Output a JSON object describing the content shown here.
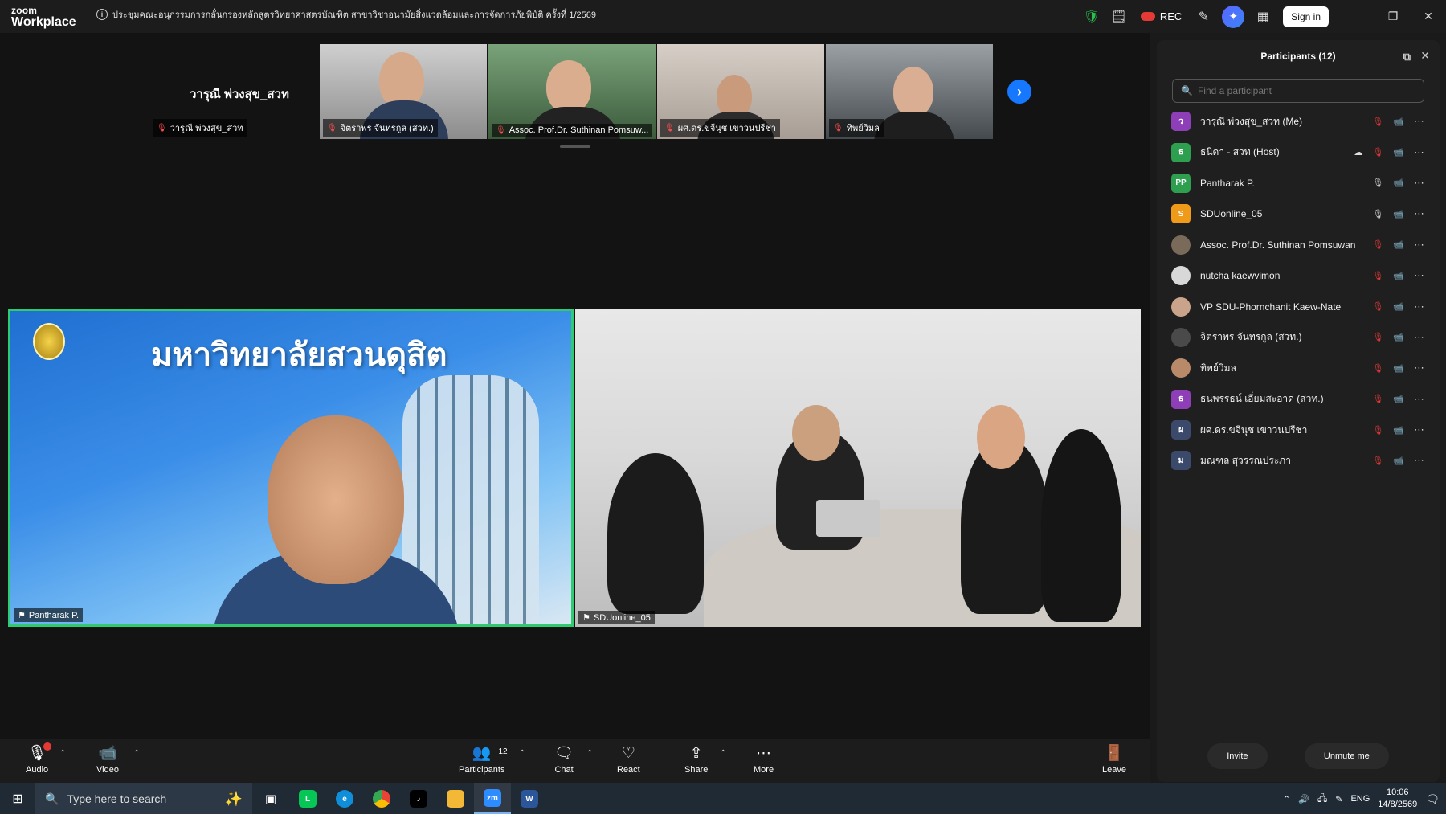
{
  "app": {
    "logo_line1": "zoom",
    "logo_line2": "Workplace"
  },
  "meeting": {
    "title": "ประชุมคณะอนุกรรมการกลั่นกรองหลักสูตรวิทยาศาสตรบัณฑิต สาขาวิชาอนามัยสิ่งแวดล้อมและการจัดการภัยพิบัติ ครั้งที่ 1/2569"
  },
  "titlebar": {
    "rec_label": "REC",
    "signin_label": "Sign in"
  },
  "thumbnails": {
    "self_display_name": "วารุณี พ่วงสุข_สวท",
    "self_label": "วารุณี พ่วงสุข_สวท",
    "tiles": [
      {
        "label": "จิตราพร จันทรกูล (สวท.)"
      },
      {
        "label": "Assoc. Prof.Dr. Suthinan Pomsuw..."
      },
      {
        "label": "ผศ.ดร.ขจีนุช เขาวนปรีชา"
      },
      {
        "label": "ทิพย์วิมล"
      }
    ]
  },
  "main_videos": {
    "left": {
      "label": "Pantharak P.",
      "banner_text": "มหาวิทยาลัยสวนดุสิต"
    },
    "right": {
      "label": "SDUonline_05"
    }
  },
  "toolbar": {
    "audio": "Audio",
    "video": "Video",
    "participants": "Participants",
    "participants_count": "12",
    "chat": "Chat",
    "react": "React",
    "share": "Share",
    "more": "More",
    "leave": "Leave"
  },
  "panel": {
    "title": "Participants (12)",
    "search_placeholder": "Find a participant",
    "invite": "Invite",
    "unmute_me": "Unmute me",
    "participants": [
      {
        "initial": "ว",
        "color": "#8e3fb8",
        "name": "วารุณี พ่วงสุข_สวท (Me)",
        "mic": "off",
        "cam": "off"
      },
      {
        "initial": "ธ",
        "color": "#2e9e4f",
        "name": "ธนิดา - สวท (Host)",
        "mic": "off",
        "cam": "on",
        "cloud": true
      },
      {
        "initial": "PP",
        "color": "#2e9e4f",
        "name": "Pantharak P.",
        "mic": "on",
        "cam": "on"
      },
      {
        "initial": "S",
        "color": "#f09a1a",
        "name": "SDUonline_05",
        "mic": "on",
        "cam": "on"
      },
      {
        "initial": "",
        "color": "#7a6a5a",
        "name": "Assoc. Prof.Dr. Suthinan Pomsuwan",
        "mic": "off",
        "cam": "on",
        "photo": true
      },
      {
        "initial": "",
        "color": "#d8d8d8",
        "name": "nutcha kaewvimon",
        "mic": "off",
        "cam": "off",
        "photo": true
      },
      {
        "initial": "",
        "color": "#c9a38a",
        "name": "VP SDU-Phornchanit Kaew-Nate",
        "mic": "off",
        "cam": "off",
        "photo": true
      },
      {
        "initial": "",
        "color": "#4a4a4a",
        "name": "จิตราพร จันทรกูล (สวท.)",
        "mic": "off",
        "cam": "on",
        "photo": true
      },
      {
        "initial": "",
        "color": "#b88a6a",
        "name": "ทิพย์วิมล",
        "mic": "off",
        "cam": "on",
        "photo": true
      },
      {
        "initial": "ธ",
        "color": "#8e3fb8",
        "name": "ธนพรรธน์ เอี่ยมสะอาด (สวท.)",
        "mic": "off",
        "cam": "off"
      },
      {
        "initial": "ผ",
        "color": "#3b4a6b",
        "name": "ผศ.ดร.ขจีนุช เขาวนปรีชา",
        "mic": "off",
        "cam": "on"
      },
      {
        "initial": "ม",
        "color": "#3b4a6b",
        "name": "มณฑล สุวรรณประภา",
        "mic": "off",
        "cam": "off"
      }
    ]
  },
  "taskbar": {
    "search_placeholder": "Type here to search",
    "language": "ENG",
    "time": "10:06",
    "date": "14/8/2569"
  },
  "icons": {
    "mic": "microphone-icon",
    "cam": "video-camera-icon"
  }
}
